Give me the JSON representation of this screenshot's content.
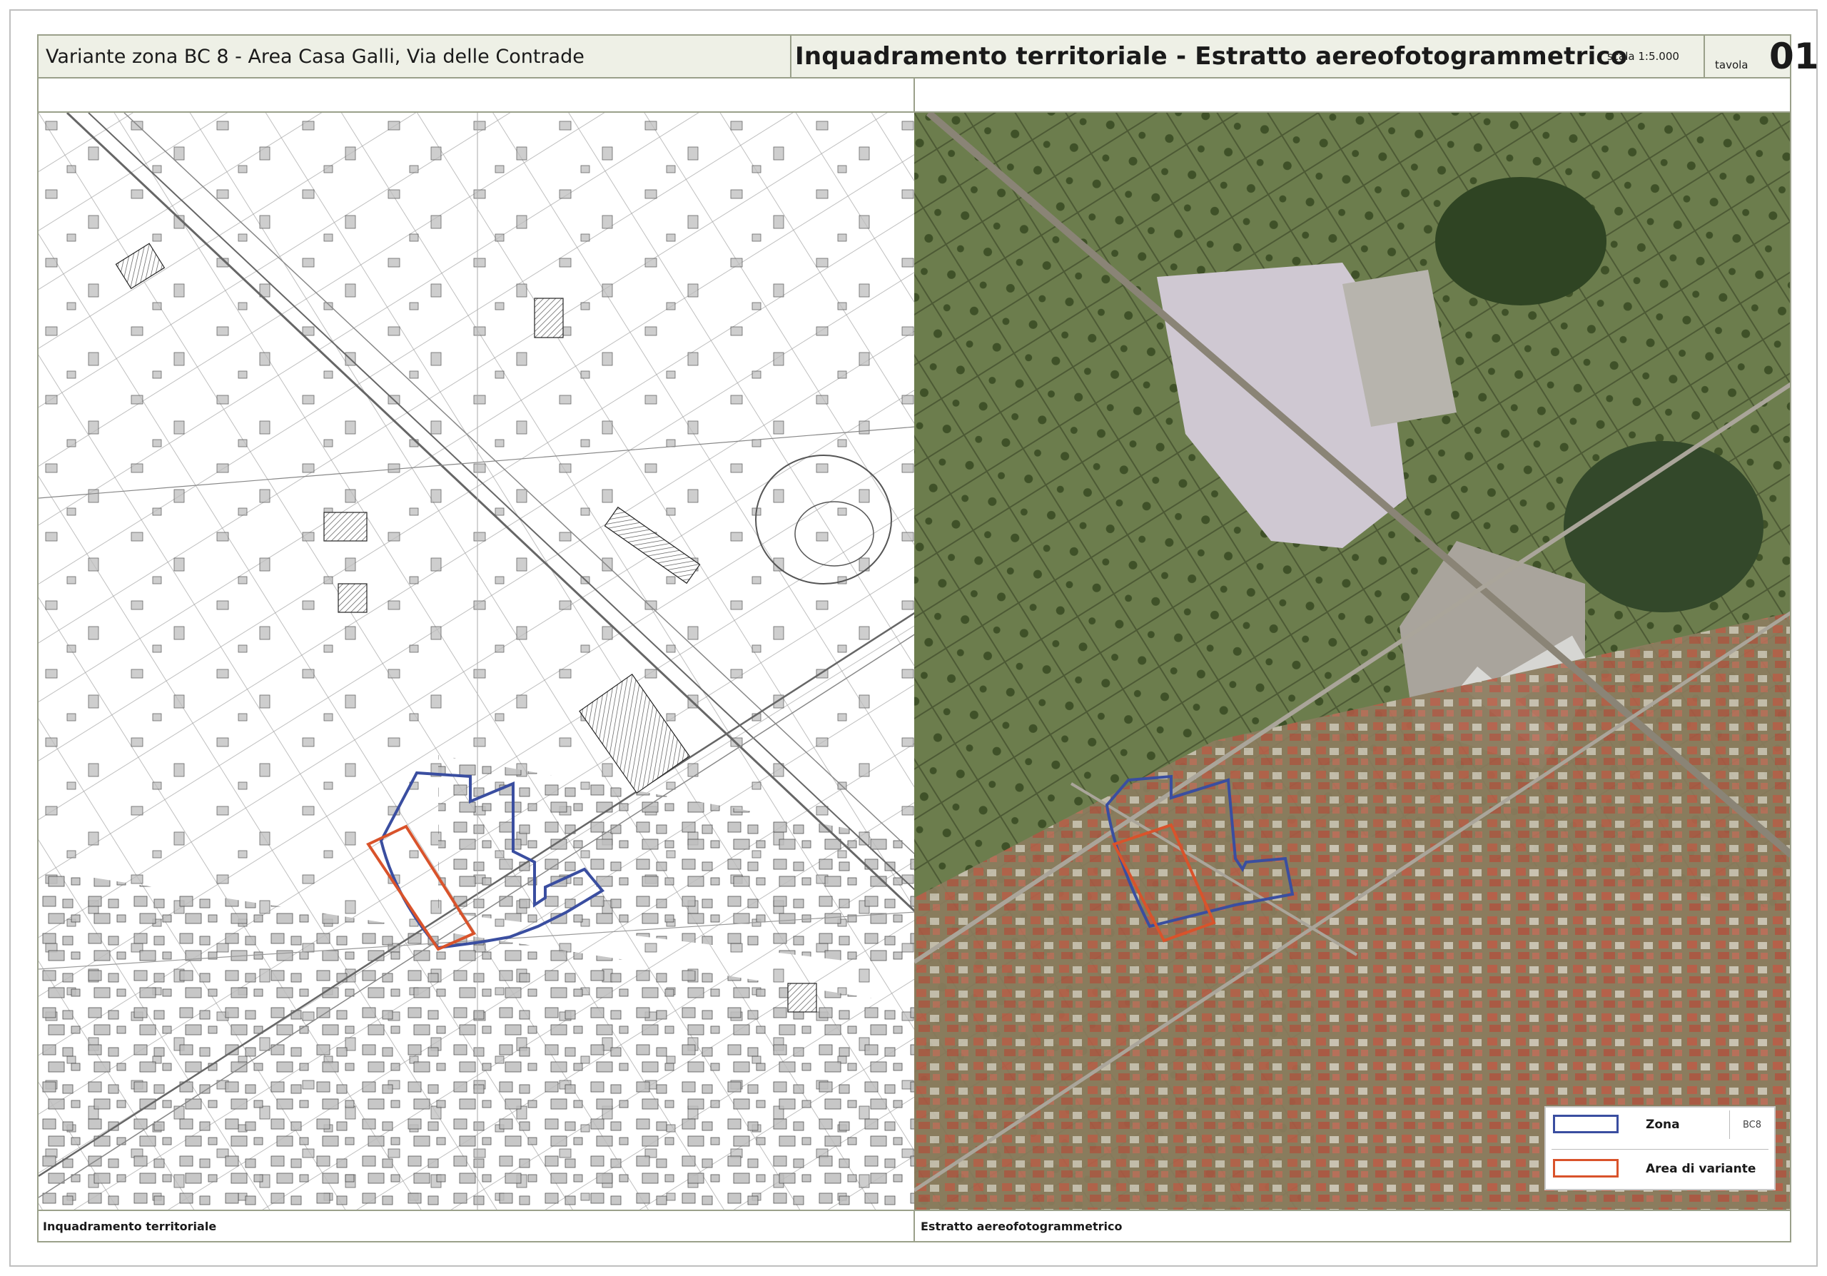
{
  "header": {
    "project_title": "Variante zona BC 8 - Area Casa Galli, Via delle Contrade",
    "sheet_title": "Inquadramento territoriale - Estratto aereofotogrammetrico",
    "scale": "scala 1:5.000",
    "tavola_label": "tavola",
    "tavola_number": "01"
  },
  "panels": {
    "left_caption": "Inquadramento territoriale",
    "right_caption": "Estratto aereofotogrammetrico"
  },
  "legend": {
    "items": [
      {
        "label": "Zona",
        "code": "BC8",
        "color": "#3a4ea0"
      },
      {
        "label": "Area di variante",
        "code": "",
        "color": "#d9532b"
      }
    ]
  },
  "colors": {
    "zona_outline": "#3a4ea0",
    "variante_outline": "#d9532b",
    "frame": "#9aa08a",
    "header_bg": "#eef0e6"
  }
}
